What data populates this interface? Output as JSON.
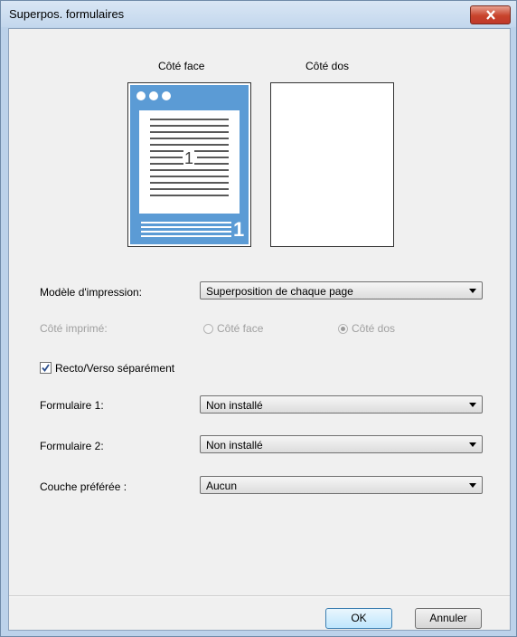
{
  "window": {
    "title": "Superpos. formulaires"
  },
  "preview": {
    "front_label": "Côté face",
    "back_label": "Côté dos",
    "page_number": "1",
    "page_number_small": "1"
  },
  "print_model": {
    "label": "Modèle d'impression:",
    "value": "Superposition de chaque page"
  },
  "printed_side": {
    "label": "Côté imprimé:",
    "options": [
      "Côté face",
      "Côté dos"
    ],
    "selected": "Côté dos",
    "enabled": false
  },
  "duplex_separately": {
    "label": "Recto/Verso séparément",
    "checked": true
  },
  "form1": {
    "label": "Formulaire 1:",
    "value": "Non installé"
  },
  "form2": {
    "label": "Formulaire 2:",
    "value": "Non installé"
  },
  "preferred_layer": {
    "label": "Couche préférée :",
    "value": "Aucun"
  },
  "buttons": {
    "ok": "OK",
    "cancel": "Annuler"
  },
  "colors": {
    "preview_blue": "#5b9bd5",
    "title_bar": "#c3d7ed",
    "close_red": "#c8432b"
  }
}
